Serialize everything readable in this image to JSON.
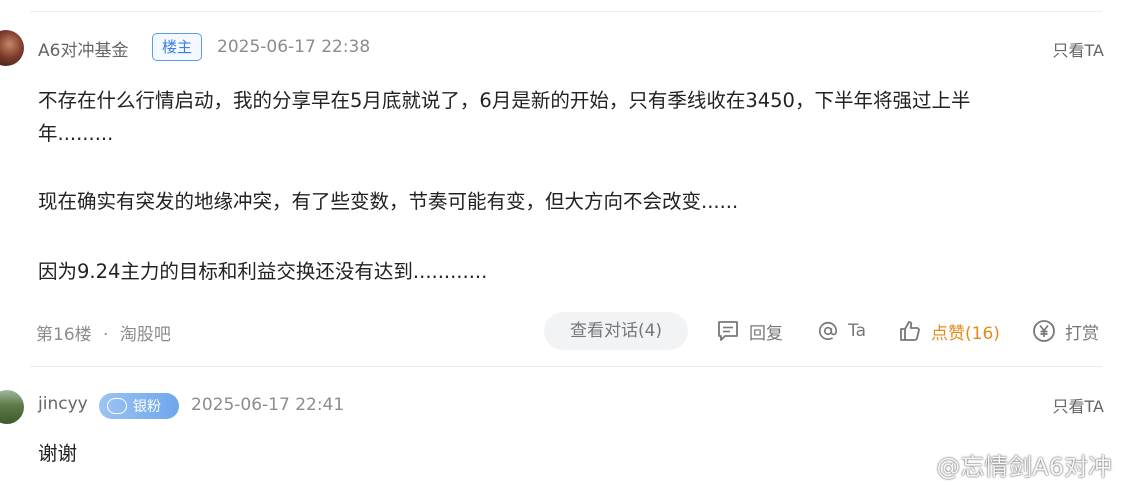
{
  "post": {
    "username": "A6对冲基金",
    "op_badge": "楼主",
    "timestamp": "2025-06-17 22:38",
    "only_ta": "只看TA",
    "paragraphs": [
      "不存在什么行情启动，我的分享早在5月底就说了，6月是新的开始，只有季线收在3450，下半年将强过上半",
      "年.........",
      "现在确实有突发的地缘冲突，有了些变数，节奏可能有变，但大方向不会改变......",
      "因为9.24主力的目标和利益交换还没有达到............"
    ],
    "floor": "第16楼",
    "separator": "·",
    "source": "淘股吧",
    "view_dialog": "查看对话(4)",
    "actions": {
      "reply": "回复",
      "mention": "Ta",
      "like": "点赞(16)",
      "reward": "打赏"
    },
    "like_color": "#e6891b"
  },
  "reply": {
    "username": "jincyy",
    "fan_badge": "银粉",
    "timestamp": "2025-06-17 22:41",
    "only_ta": "只看TA",
    "text": "谢谢"
  },
  "watermark": "@忘情剑A6对冲",
  "icons": {
    "reply": "comment-icon",
    "mention": "at-icon",
    "like": "thumbs-up-icon",
    "reward": "yen-coin-icon",
    "watermark": "weibo-logo"
  }
}
